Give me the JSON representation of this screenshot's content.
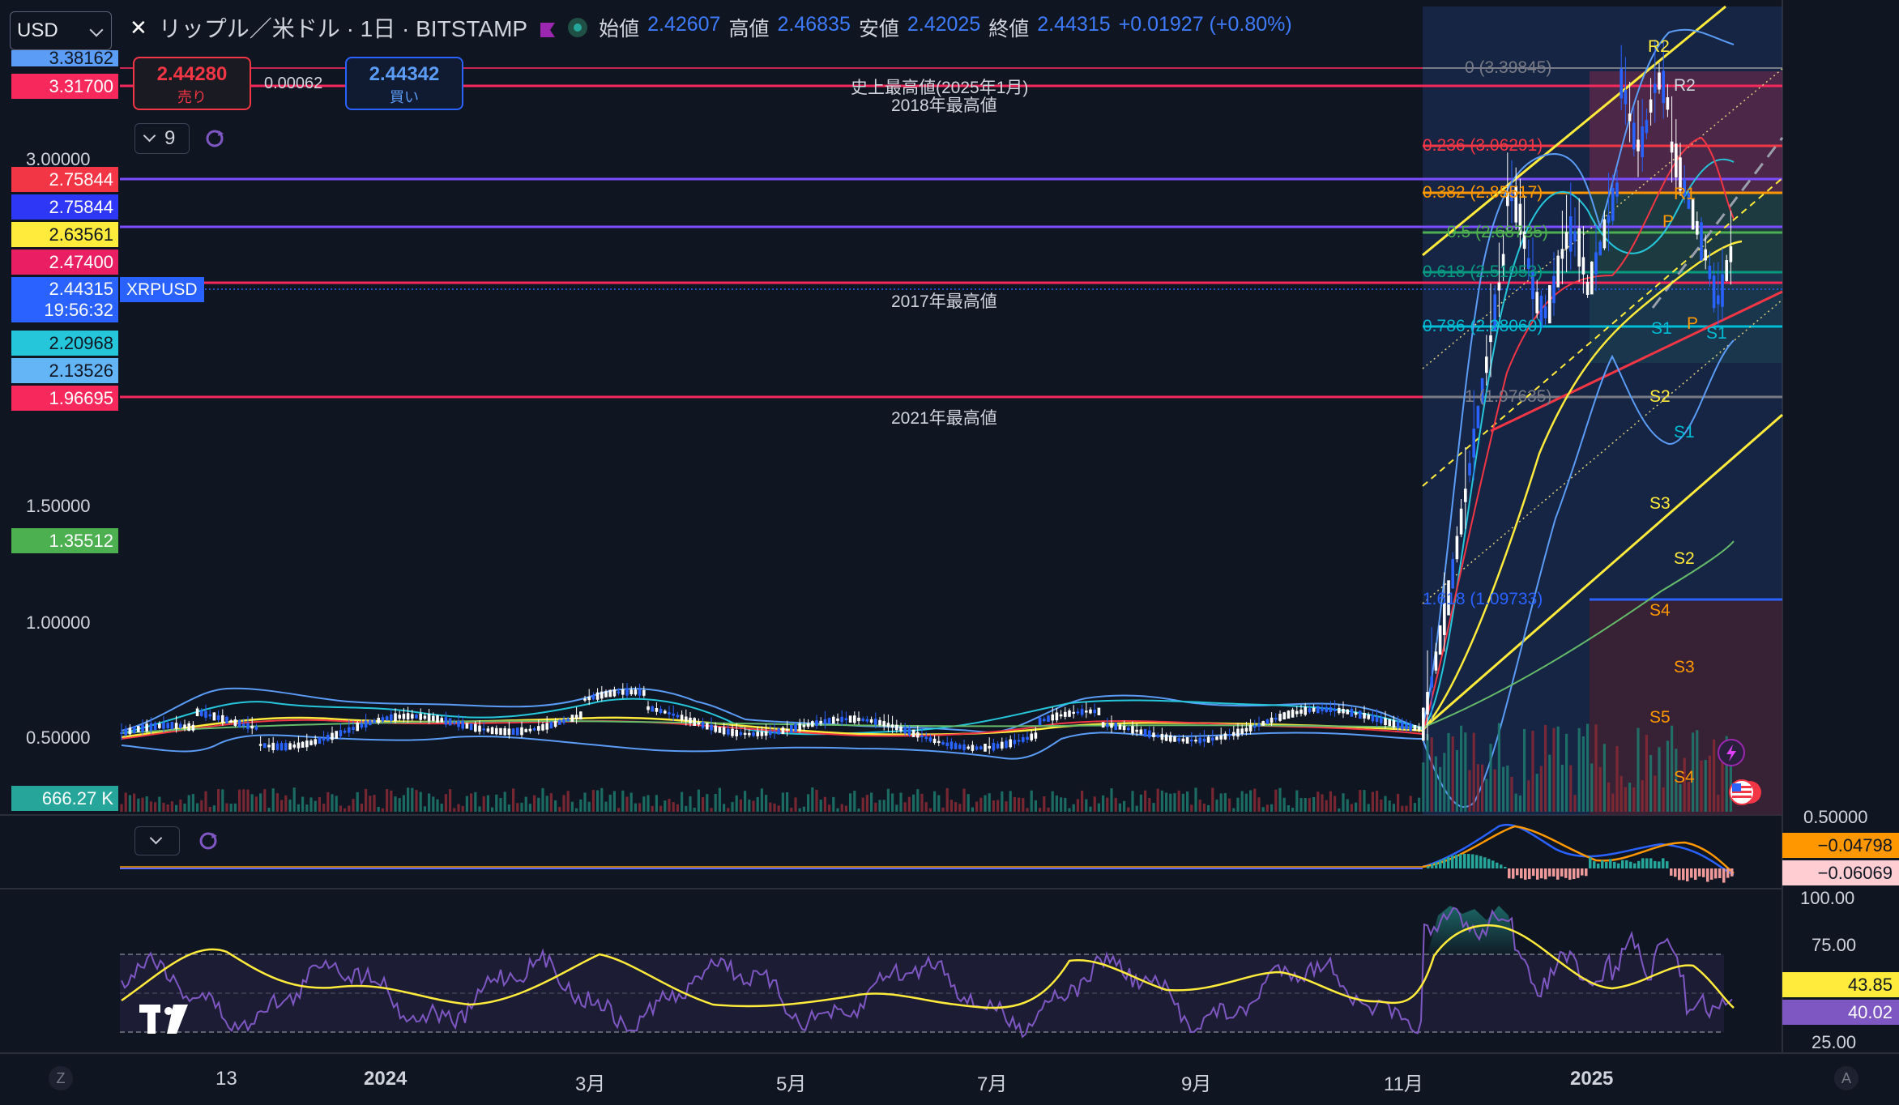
{
  "header": {
    "close_symbol": "✕",
    "title": "リップル／米ドル · 1日 · BITSTAMP",
    "ohlc": [
      {
        "label": "始値",
        "value": "2.42607"
      },
      {
        "label": "高値",
        "value": "2.46835"
      },
      {
        "label": "安値",
        "value": "2.42025"
      },
      {
        "label": "終値",
        "value": "2.44315"
      }
    ],
    "change": "+0.01927 (+0.80%)",
    "accent_color": "#3e7bfa"
  },
  "currency_select": {
    "value": "USD"
  },
  "trade": {
    "sell_price": "2.44280",
    "sell_label": "売り",
    "spread": "0.00062",
    "buy_price": "2.44342",
    "buy_label": "買い"
  },
  "indicator_toggle": {
    "count": "9"
  },
  "annotations": [
    {
      "text": "史上最高値(2025年1月)"
    },
    {
      "text": "2018年最高値"
    },
    {
      "text": "2017年最高値"
    },
    {
      "text": "2021年最高値"
    }
  ],
  "fib_levels": [
    {
      "text": "0 (3.39845)",
      "color": "#787b86"
    },
    {
      "text": "0.236 (3.06291)",
      "color": "#f23645"
    },
    {
      "text": "0.382 (2.85517)",
      "color": "#ff9800"
    },
    {
      "text": "0.5 (2.68735)",
      "color": "#4caf50"
    },
    {
      "text": "0.618 (2.51953)",
      "color": "#089981"
    },
    {
      "text": "0.786 (2.28060)",
      "color": "#00bcd4"
    },
    {
      "text": "1 (1.97635)",
      "color": "#787b86"
    },
    {
      "text": "1.618 (1.09733)",
      "color": "#2962ff"
    }
  ],
  "pivot_labels": [
    "R2",
    "R2",
    "R1",
    "P",
    "P",
    "S1",
    "S1",
    "S2",
    "S1",
    "S3",
    "S2",
    "S4",
    "S3",
    "S5",
    "S4"
  ],
  "price_axis": {
    "ticks": [
      "3.00000",
      "1.50000",
      "1.00000",
      "0.50000"
    ],
    "labels": [
      {
        "text": "3.38162",
        "bg": "#5b9cf6",
        "fg": "#0f1521"
      },
      {
        "text": "3.31700",
        "bg": "#f7295c",
        "fg": "#ffffff"
      },
      {
        "text": "2.75844",
        "bg": "#f23645",
        "fg": "#ffffff"
      },
      {
        "text": "2.75844",
        "bg": "#2e37f5",
        "fg": "#ffffff"
      },
      {
        "text": "2.63561",
        "bg": "#ffeb3b",
        "fg": "#0f1521"
      },
      {
        "text": "2.47400",
        "bg": "#e91e63",
        "fg": "#ffffff"
      },
      {
        "text": "2.44315",
        "bg": "#2962ff",
        "fg": "#ffffff"
      },
      {
        "text": "19:56:32",
        "bg": "#2962ff",
        "fg": "#ffffff"
      },
      {
        "text": "2.20968",
        "bg": "#26c6da",
        "fg": "#0f1521"
      },
      {
        "text": "2.13526",
        "bg": "#64b5f6",
        "fg": "#0f1521"
      },
      {
        "text": "1.96695",
        "bg": "#f7295c",
        "fg": "#ffffff"
      },
      {
        "text": "1.35512",
        "bg": "#4caf50",
        "fg": "#ffffff"
      }
    ],
    "symbol_tag": "XRPUSD",
    "volume_label": "666.27 K"
  },
  "macd_axis": {
    "top_tick": "0.50000",
    "labels": [
      {
        "text": "−0.04798",
        "bg": "#ff9800",
        "fg": "#0f1521"
      },
      {
        "text": "−0.06069",
        "bg": "#ffcdd2",
        "fg": "#0f1521"
      }
    ]
  },
  "rsi_axis": {
    "ticks": [
      "100.00",
      "75.00",
      "25.00"
    ],
    "labels": [
      {
        "text": "43.85",
        "bg": "#ffeb3b",
        "fg": "#0f1521"
      },
      {
        "text": "40.02",
        "bg": "#7e57c2",
        "fg": "#ffffff"
      }
    ]
  },
  "time_axis": {
    "labels": [
      "13",
      "2024",
      "3月",
      "5月",
      "7月",
      "9月",
      "11月",
      "2025"
    ],
    "left_button": "Z",
    "right_button": "A"
  }
}
